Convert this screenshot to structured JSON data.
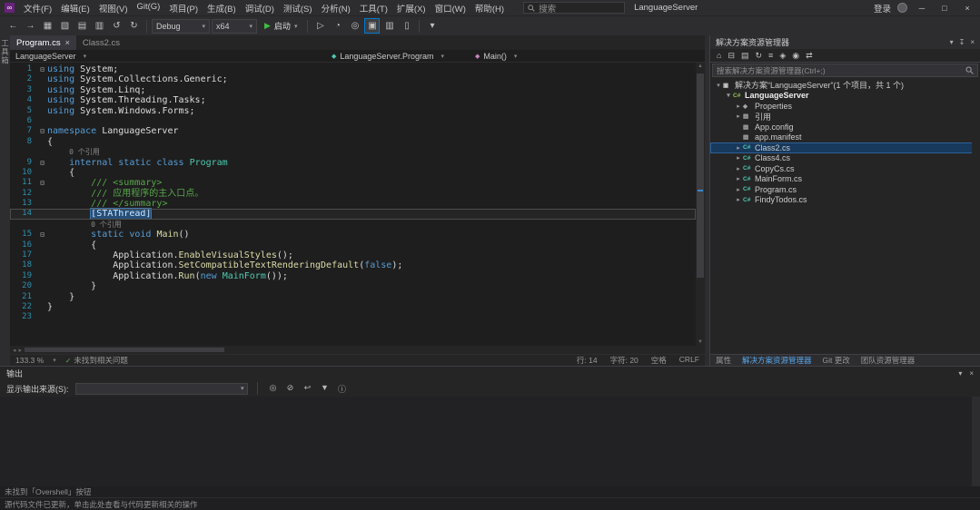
{
  "window": {
    "search_placeholder": "搜索",
    "solution_name": "LanguageServer",
    "sign_in": "登录",
    "minimize_glyph": "─",
    "maximize_glyph": "□",
    "close_glyph": "×"
  },
  "menu": {
    "items": [
      "文件(F)",
      "编辑(E)",
      "视图(V)",
      "Git(G)",
      "项目(P)",
      "生成(B)",
      "调试(D)",
      "测试(S)",
      "分析(N)",
      "工具(T)",
      "扩展(X)",
      "窗口(W)",
      "帮助(H)"
    ]
  },
  "toolbar": {
    "icons_left": [
      {
        "name": "back-icon",
        "glyph": "←"
      },
      {
        "name": "forward-icon",
        "glyph": "→"
      },
      {
        "name": "new-project-icon",
        "glyph": "▦"
      },
      {
        "name": "open-file-icon",
        "glyph": "▧"
      },
      {
        "name": "save-icon",
        "glyph": "▤"
      },
      {
        "name": "save-all-icon",
        "glyph": "▥"
      },
      {
        "name": "undo-icon",
        "glyph": "↺"
      },
      {
        "name": "redo-icon",
        "glyph": "↻"
      }
    ],
    "config_label": "Debug",
    "platform_label": "x64",
    "start_label": "启动",
    "icons_right": [
      {
        "name": "start-without-debugging-icon",
        "glyph": "▷"
      },
      {
        "name": "profiler-icon",
        "glyph": "◔"
      },
      {
        "name": "find-in-files-icon",
        "glyph": "◎"
      },
      {
        "name": "preview-changes-icon",
        "glyph": "▣",
        "active": true
      },
      {
        "name": "line-comment-icon",
        "glyph": "▥"
      },
      {
        "name": "bookmark-icon",
        "glyph": "▯"
      }
    ],
    "overflow_glyph": "▾"
  },
  "left_strip": {
    "tabs": [
      {
        "label": "工具箱"
      }
    ]
  },
  "editor": {
    "tabs": [
      {
        "label": "Program.cs",
        "active": true
      },
      {
        "label": "Class2.cs",
        "active": false
      }
    ],
    "breadcrumb": {
      "project": "LanguageServer",
      "type": "LanguageServer.Program",
      "member": "Main()"
    },
    "code": [
      {
        "n": 1,
        "fold": true,
        "segs": [
          [
            "using",
            "k"
          ],
          [
            " System;",
            "p"
          ]
        ]
      },
      {
        "n": 2,
        "segs": [
          [
            "using",
            "k"
          ],
          [
            " System.Collections.Generic;",
            "p"
          ]
        ]
      },
      {
        "n": 3,
        "segs": [
          [
            "using",
            "k"
          ],
          [
            " System.Linq;",
            "p"
          ]
        ]
      },
      {
        "n": 4,
        "segs": [
          [
            "using",
            "k"
          ],
          [
            " System.Threading.Tasks;",
            "p"
          ]
        ]
      },
      {
        "n": 5,
        "segs": [
          [
            "using",
            "k"
          ],
          [
            " System.Windows.Forms;",
            "p"
          ]
        ]
      },
      {
        "n": 6,
        "segs": []
      },
      {
        "n": 7,
        "fold": true,
        "segs": [
          [
            "namespace",
            "k"
          ],
          [
            " LanguageServer",
            "p"
          ]
        ]
      },
      {
        "n": 8,
        "segs": [
          [
            "{",
            "p"
          ]
        ]
      },
      {
        "lens": true,
        "segs": [
          [
            "    ",
            "p"
          ],
          [
            "0 个引用",
            "lens"
          ]
        ]
      },
      {
        "n": 9,
        "fold": true,
        "segs": [
          [
            "    ",
            "p"
          ],
          [
            "internal static class",
            "k"
          ],
          [
            " ",
            "p"
          ],
          [
            "Program",
            "t"
          ]
        ]
      },
      {
        "n": 10,
        "segs": [
          [
            "    {",
            "p"
          ]
        ]
      },
      {
        "n": 11,
        "fold": true,
        "segs": [
          [
            "        ",
            "p"
          ],
          [
            "/// <summary>",
            "c"
          ]
        ]
      },
      {
        "n": 12,
        "segs": [
          [
            "        ",
            "p"
          ],
          [
            "/// 应用程序的主入口点。",
            "c"
          ]
        ]
      },
      {
        "n": 13,
        "segs": [
          [
            "        ",
            "p"
          ],
          [
            "/// </summary>",
            "c"
          ]
        ]
      },
      {
        "n": 14,
        "current": true,
        "segs": [
          [
            "        ",
            "p"
          ],
          [
            "[STAThread]",
            "sel"
          ]
        ]
      },
      {
        "lens": true,
        "segs": [
          [
            "        ",
            "p"
          ],
          [
            "0 个引用",
            "lens"
          ]
        ]
      },
      {
        "n": 15,
        "fold": true,
        "segs": [
          [
            "        ",
            "p"
          ],
          [
            "static void",
            "k"
          ],
          [
            " ",
            "p"
          ],
          [
            "Main",
            "m"
          ],
          [
            "()",
            "p"
          ]
        ]
      },
      {
        "n": 16,
        "segs": [
          [
            "        {",
            "p"
          ]
        ]
      },
      {
        "n": 17,
        "segs": [
          [
            "            Application.",
            "p"
          ],
          [
            "EnableVisualStyles",
            "m"
          ],
          [
            "();",
            "p"
          ]
        ]
      },
      {
        "n": 18,
        "segs": [
          [
            "            Application.",
            "p"
          ],
          [
            "SetCompatibleTextRenderingDefault",
            "m"
          ],
          [
            "(",
            "p"
          ],
          [
            "false",
            "k"
          ],
          [
            ");",
            "p"
          ]
        ]
      },
      {
        "n": 19,
        "segs": [
          [
            "            Application.",
            "p"
          ],
          [
            "Run",
            "m"
          ],
          [
            "(",
            "p"
          ],
          [
            "new",
            "k"
          ],
          [
            " ",
            "p"
          ],
          [
            "MainForm",
            "t"
          ],
          [
            "());",
            "p"
          ]
        ]
      },
      {
        "n": 20,
        "segs": [
          [
            "        }",
            "p"
          ]
        ]
      },
      {
        "n": 21,
        "segs": [
          [
            "    }",
            "p"
          ]
        ]
      },
      {
        "n": 22,
        "segs": [
          [
            "}",
            "p"
          ]
        ]
      },
      {
        "n": 23,
        "segs": []
      }
    ],
    "status": {
      "zoom": "133.3 %",
      "health": "未找到相关问题",
      "line": "行: 14",
      "column": "字符: 20",
      "spaces": "空格",
      "encoding": "CRLF"
    }
  },
  "solution_explorer": {
    "title": "解决方案资源管理器",
    "toolbar_icons": [
      {
        "name": "home-icon",
        "glyph": "⌂"
      },
      {
        "name": "collapse-all-icon",
        "glyph": "⊟"
      },
      {
        "name": "show-all-files-icon",
        "glyph": "▤"
      },
      {
        "name": "refresh-icon",
        "glyph": "↻"
      },
      {
        "name": "nest-files-icon",
        "glyph": "≡"
      },
      {
        "name": "properties-icon",
        "glyph": "◈"
      },
      {
        "name": "preview-icon",
        "glyph": "◉"
      },
      {
        "name": "sync-icon",
        "glyph": "⇄"
      }
    ],
    "search_placeholder": "搜索解决方案资源管理器(Ctrl+;)",
    "tree": [
      {
        "indent": 0,
        "arrow": "▾",
        "icon": "solution",
        "label": "解决方案“LanguageServer”(1 个项目，共 1 个)"
      },
      {
        "indent": 1,
        "arrow": "▾",
        "icon": "csproj",
        "label": "LanguageServer",
        "bold": true
      },
      {
        "indent": 2,
        "arrow": "▸",
        "icon": "properties",
        "label": "Properties"
      },
      {
        "indent": 2,
        "arrow": "▸",
        "icon": "references",
        "label": "引用"
      },
      {
        "indent": 2,
        "arrow": "",
        "icon": "config",
        "label": "App.config"
      },
      {
        "indent": 2,
        "arrow": "",
        "icon": "manifest",
        "label": "app.manifest"
      },
      {
        "indent": 2,
        "arrow": "▸",
        "icon": "cs",
        "label": "Class2.cs",
        "selected": true
      },
      {
        "indent": 2,
        "arrow": "▸",
        "icon": "cs",
        "label": "Class4.cs"
      },
      {
        "indent": 2,
        "arrow": "▸",
        "icon": "cs",
        "label": "CopyCs.cs"
      },
      {
        "indent": 2,
        "arrow": "▸",
        "icon": "cs",
        "label": "MainForm.cs"
      },
      {
        "indent": 2,
        "arrow": "▸",
        "icon": "cs",
        "label": "Program.cs"
      },
      {
        "indent": 2,
        "arrow": "▸",
        "icon": "cs",
        "label": "FindyTodos.cs"
      }
    ],
    "bottom_tabs": [
      {
        "label": "属性"
      },
      {
        "label": "解决方案资源管理器",
        "active": true
      },
      {
        "label": "Git 更改"
      },
      {
        "label": "团队资源管理器"
      }
    ]
  },
  "output": {
    "title": "输出",
    "source_label": "显示输出来源(S):",
    "source_value": "",
    "toolbar_icons": [
      {
        "name": "find-icon",
        "glyph": "◎"
      },
      {
        "name": "clear-all-icon",
        "glyph": "⊘"
      },
      {
        "name": "wrap-icon",
        "glyph": "↩"
      },
      {
        "name": "scroll-lock-icon",
        "glyph": "▼"
      },
      {
        "name": "info-icon",
        "glyph": "ⓘ"
      }
    ]
  },
  "status": {
    "notification": "未找到「Overshell」按钮",
    "message": "源代码文件已更新，单击此处查看与代码更新相关的操作"
  }
}
